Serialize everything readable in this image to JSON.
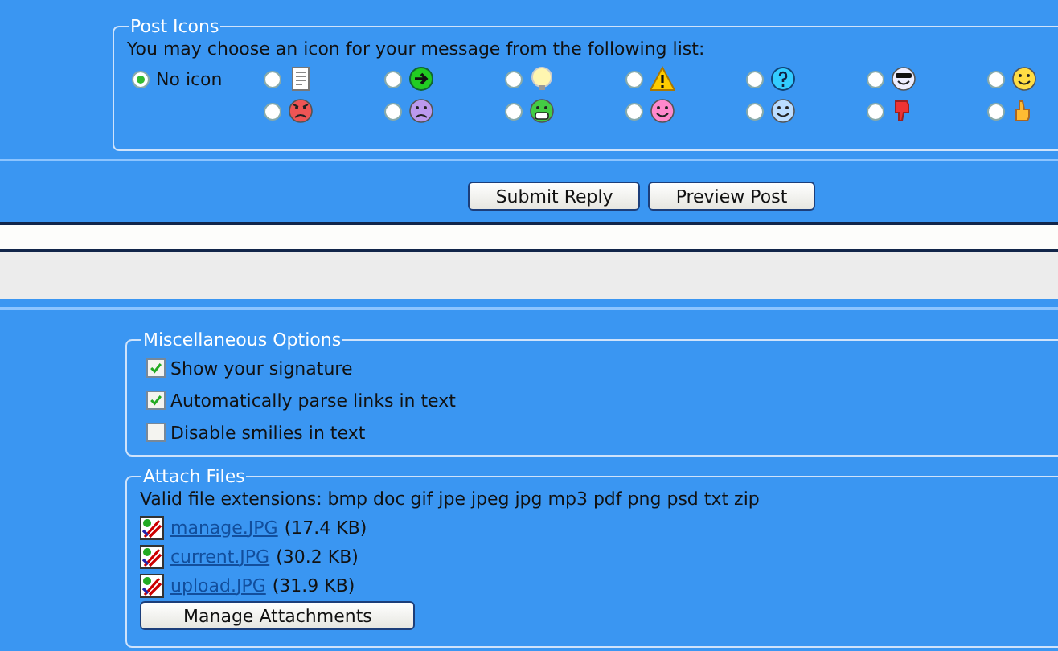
{
  "post_icons": {
    "legend": "Post Icons",
    "prompt": "You may choose an icon for your message from the following list:",
    "no_icon": {
      "label": "No icon",
      "selected": true
    },
    "icons": [
      {
        "kind": "document",
        "selected": false
      },
      {
        "kind": "arrow",
        "selected": false
      },
      {
        "kind": "lightbulb",
        "selected": false
      },
      {
        "kind": "warning",
        "selected": false
      },
      {
        "kind": "question",
        "selected": false
      },
      {
        "kind": "cool",
        "selected": false
      },
      {
        "kind": "smile",
        "selected": false
      },
      {
        "kind": "angry",
        "selected": false
      },
      {
        "kind": "sad",
        "selected": false
      },
      {
        "kind": "grin",
        "selected": false
      },
      {
        "kind": "pinksmile",
        "selected": false
      },
      {
        "kind": "wink",
        "selected": false
      },
      {
        "kind": "thumbsdown",
        "selected": false
      },
      {
        "kind": "thumbsup",
        "selected": false
      }
    ]
  },
  "buttons": [
    "Submit Reply",
    "Preview Post"
  ],
  "misc_options": {
    "legend": "Miscellaneous Options",
    "options": [
      {
        "label": "Show your signature",
        "checked": true
      },
      {
        "label": "Automatically parse links in text",
        "checked": true
      },
      {
        "label": "Disable smilies in text",
        "checked": false
      }
    ]
  },
  "attach_files": {
    "legend": "Attach Files",
    "extensions": "Valid file extensions: bmp doc gif jpe jpeg jpg mp3 pdf png psd txt zip",
    "files": [
      {
        "name": "manage.JPG",
        "size": "(17.4 KB)"
      },
      {
        "name": "current.JPG",
        "size": "(30.2 KB)"
      },
      {
        "name": "upload.JPG",
        "size": "(31.9 KB)"
      }
    ],
    "button": "Manage Attachments"
  }
}
